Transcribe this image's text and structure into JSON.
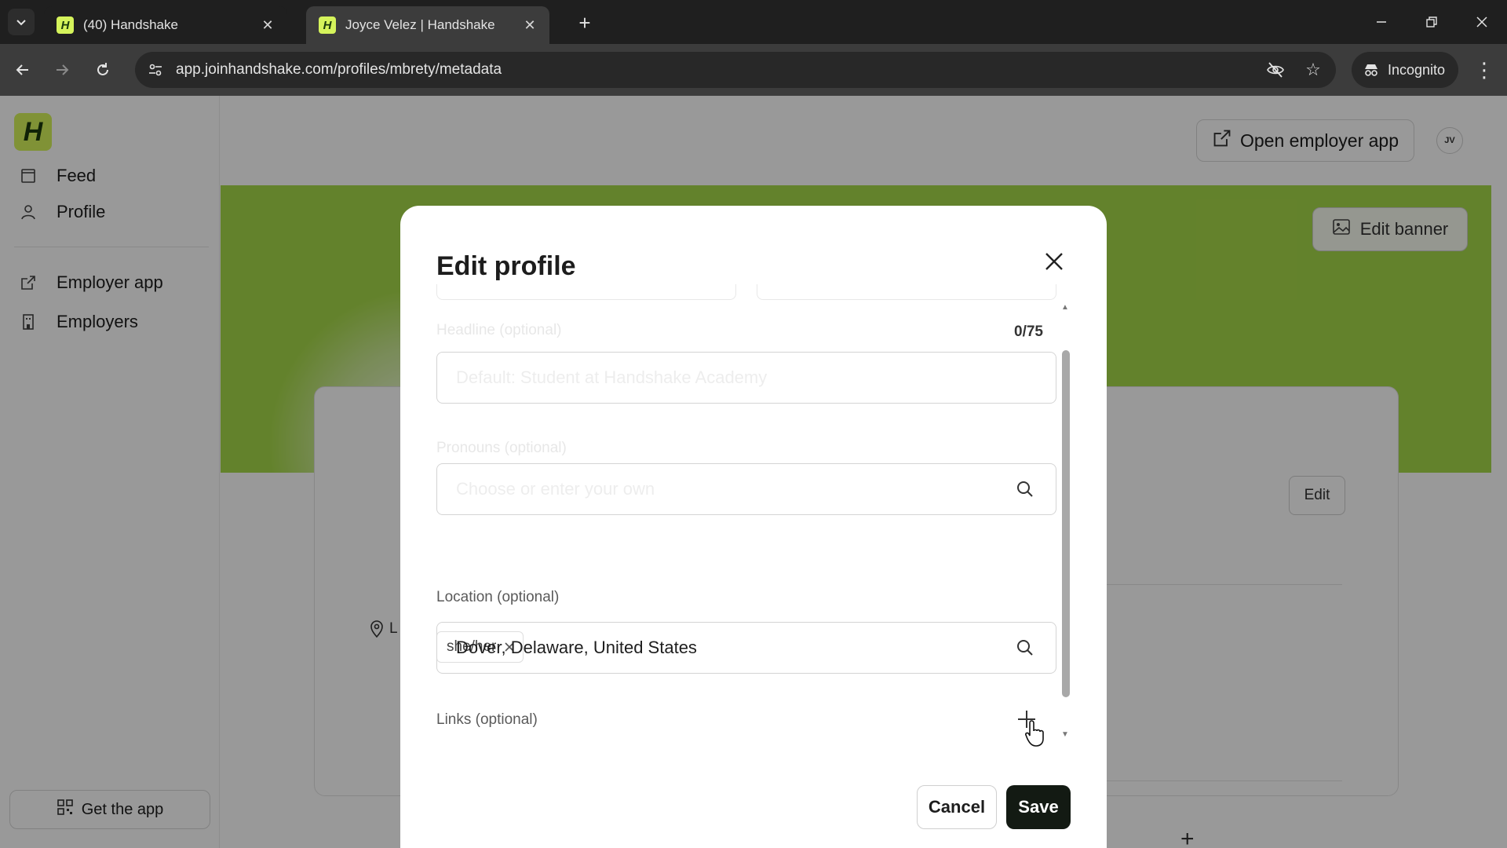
{
  "browser": {
    "tabs": [
      {
        "title": "(40) Handshake",
        "active": false
      },
      {
        "title": "Joyce Velez | Handshake",
        "active": true
      }
    ],
    "tab_favicon": "H",
    "url": "app.joinhandshake.com/profiles/mbrety/metadata",
    "incognito_label": "Incognito"
  },
  "sidebar": {
    "logo": "H",
    "items": [
      {
        "label": "Feed",
        "icon": "feed-icon"
      },
      {
        "label": "Profile",
        "icon": "person-icon"
      },
      {
        "label": "Employer app",
        "icon": "external-link-icon"
      },
      {
        "label": "Employers",
        "icon": "building-icon"
      }
    ],
    "get_app_label": "Get the app"
  },
  "header": {
    "open_employer_label": "Open employer app",
    "avatar_initials": "JV"
  },
  "profile": {
    "edit_banner_label": "Edit banner",
    "edit_label": "Edit",
    "location_peek": "L"
  },
  "modal": {
    "title": "Edit profile",
    "headline": {
      "label": "Headline (optional)",
      "counter": "0/75",
      "placeholder": "Default: Student at Handshake Academy"
    },
    "pronouns": {
      "label": "Pronouns (optional)",
      "placeholder": "Choose or enter your own",
      "chip": "she/her"
    },
    "location": {
      "label": "Location (optional)",
      "value": "Dover, Delaware, United States"
    },
    "links": {
      "label": "Links (optional)"
    },
    "cancel_label": "Cancel",
    "save_label": "Save"
  },
  "colors": {
    "brand": "#d5f35b",
    "banner": "#a6d94a",
    "save_button": "#131a13"
  }
}
